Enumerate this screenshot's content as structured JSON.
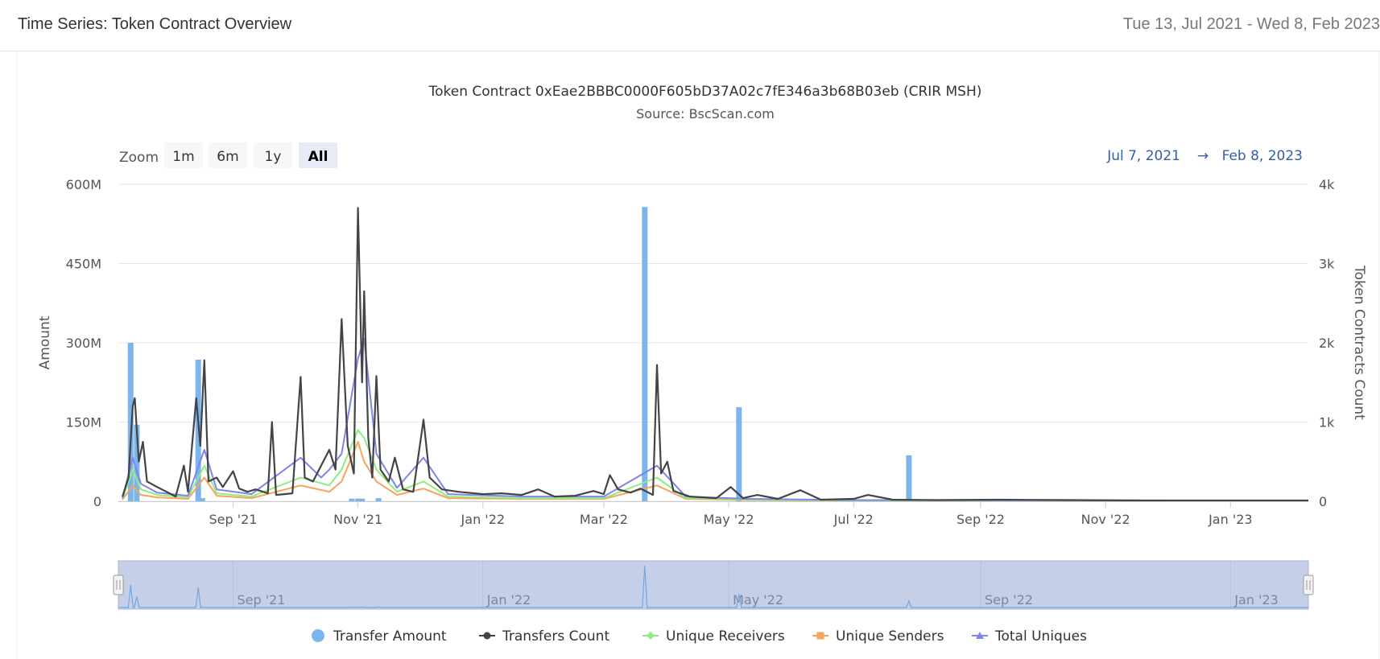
{
  "header": {
    "title": "Time Series: Token Contract Overview",
    "date_range": "Tue 13, Jul 2021 - Wed 8, Feb 2023"
  },
  "chart_data": {
    "type": "line",
    "title": "Token Contract 0xEae2BBBC0000F605bD37A02c7fE346a3b68B03eb (CRIR MSH)",
    "subtitle": "Source: BscScan.com",
    "ylabel_left": "Amount",
    "ylabel_right": "Token Contracts Count",
    "ylim_left": [
      0,
      600000000
    ],
    "ylim_right": [
      0,
      4000
    ],
    "yticks_left": [
      "0",
      "150M",
      "300M",
      "450M",
      "600M"
    ],
    "yticks_right": [
      "0",
      "1k",
      "2k",
      "3k",
      "4k"
    ],
    "xlim": [
      "2021-07-07",
      "2023-02-08"
    ],
    "xticks": [
      {
        "date": "2021-09-01",
        "label": "Sep '21"
      },
      {
        "date": "2021-11-01",
        "label": "Nov '21"
      },
      {
        "date": "2022-01-01",
        "label": "Jan '22"
      },
      {
        "date": "2022-03-01",
        "label": "Mar '22"
      },
      {
        "date": "2022-05-01",
        "label": "May '22"
      },
      {
        "date": "2022-07-01",
        "label": "Jul '22"
      },
      {
        "date": "2022-09-01",
        "label": "Sep '22"
      },
      {
        "date": "2022-11-01",
        "label": "Nov '22"
      },
      {
        "date": "2023-01-01",
        "label": "Jan '23"
      }
    ],
    "navigator_ticks": [
      {
        "date": "2021-09-01",
        "label": "Sep '21"
      },
      {
        "date": "2022-01-01",
        "label": "Jan '22"
      },
      {
        "date": "2022-05-01",
        "label": "May '22"
      },
      {
        "date": "2022-09-01",
        "label": "Sep '22"
      },
      {
        "date": "2023-01-01",
        "label": "Jan '23"
      }
    ],
    "grid": true,
    "legend_position": "bottom",
    "series": [
      {
        "name": "Transfer Amount",
        "type": "column",
        "axis": "left",
        "color": "#7cb5ec",
        "points": [
          [
            "2021-07-13",
            300000000
          ],
          [
            "2021-07-16",
            145000000
          ],
          [
            "2021-08-15",
            268000000
          ],
          [
            "2021-08-17",
            6000000
          ],
          [
            "2021-10-29",
            5000000
          ],
          [
            "2021-11-01",
            5000000
          ],
          [
            "2021-11-03",
            5000000
          ],
          [
            "2021-11-11",
            6000000
          ],
          [
            "2022-03-21",
            557000000
          ],
          [
            "2022-05-06",
            178000000
          ],
          [
            "2022-07-28",
            87000000
          ]
        ]
      },
      {
        "name": "Transfers Count",
        "type": "line",
        "axis": "right",
        "color": "#434348",
        "points": [
          [
            "2021-07-09",
            60
          ],
          [
            "2021-07-12",
            300
          ],
          [
            "2021-07-14",
            1200
          ],
          [
            "2021-07-15",
            1300
          ],
          [
            "2021-07-17",
            500
          ],
          [
            "2021-07-19",
            750
          ],
          [
            "2021-07-21",
            250
          ],
          [
            "2021-07-26",
            180
          ],
          [
            "2021-08-01",
            100
          ],
          [
            "2021-08-04",
            60
          ],
          [
            "2021-08-08",
            450
          ],
          [
            "2021-08-10",
            120
          ],
          [
            "2021-08-14",
            1300
          ],
          [
            "2021-08-16",
            700
          ],
          [
            "2021-08-18",
            1780
          ],
          [
            "2021-08-20",
            250
          ],
          [
            "2021-08-24",
            300
          ],
          [
            "2021-08-27",
            180
          ],
          [
            "2021-09-01",
            380
          ],
          [
            "2021-09-04",
            160
          ],
          [
            "2021-09-08",
            120
          ],
          [
            "2021-09-12",
            150
          ],
          [
            "2021-09-18",
            100
          ],
          [
            "2021-09-20",
            1000
          ],
          [
            "2021-09-22",
            80
          ],
          [
            "2021-09-30",
            100
          ],
          [
            "2021-10-04",
            1570
          ],
          [
            "2021-10-06",
            300
          ],
          [
            "2021-10-10",
            250
          ],
          [
            "2021-10-14",
            450
          ],
          [
            "2021-10-18",
            650
          ],
          [
            "2021-10-21",
            400
          ],
          [
            "2021-10-24",
            2300
          ],
          [
            "2021-10-27",
            700
          ],
          [
            "2021-10-30",
            350
          ],
          [
            "2021-11-01",
            3700
          ],
          [
            "2021-11-03",
            1500
          ],
          [
            "2021-11-04",
            2650
          ],
          [
            "2021-11-06",
            800
          ],
          [
            "2021-11-08",
            300
          ],
          [
            "2021-11-10",
            1580
          ],
          [
            "2021-11-12",
            400
          ],
          [
            "2021-11-16",
            250
          ],
          [
            "2021-11-19",
            550
          ],
          [
            "2021-11-23",
            150
          ],
          [
            "2021-11-28",
            120
          ],
          [
            "2021-12-03",
            1030
          ],
          [
            "2021-12-06",
            300
          ],
          [
            "2021-12-12",
            150
          ],
          [
            "2021-12-20",
            120
          ],
          [
            "2022-01-01",
            90
          ],
          [
            "2022-01-10",
            100
          ],
          [
            "2022-01-20",
            80
          ],
          [
            "2022-01-28",
            150
          ],
          [
            "2022-02-05",
            60
          ],
          [
            "2022-02-15",
            70
          ],
          [
            "2022-02-24",
            130
          ],
          [
            "2022-03-01",
            90
          ],
          [
            "2022-03-04",
            330
          ],
          [
            "2022-03-08",
            150
          ],
          [
            "2022-03-14",
            110
          ],
          [
            "2022-03-19",
            160
          ],
          [
            "2022-03-25",
            80
          ],
          [
            "2022-03-27",
            1720
          ],
          [
            "2022-03-29",
            350
          ],
          [
            "2022-04-01",
            500
          ],
          [
            "2022-04-04",
            130
          ],
          [
            "2022-04-12",
            60
          ],
          [
            "2022-04-25",
            40
          ],
          [
            "2022-05-02",
            180
          ],
          [
            "2022-05-08",
            40
          ],
          [
            "2022-05-15",
            80
          ],
          [
            "2022-05-25",
            30
          ],
          [
            "2022-06-05",
            140
          ],
          [
            "2022-06-15",
            20
          ],
          [
            "2022-07-01",
            30
          ],
          [
            "2022-07-08",
            80
          ],
          [
            "2022-07-20",
            20
          ],
          [
            "2022-08-10",
            15
          ],
          [
            "2022-09-10",
            20
          ],
          [
            "2022-10-15",
            15
          ],
          [
            "2022-11-20",
            10
          ],
          [
            "2023-01-01",
            10
          ],
          [
            "2023-02-08",
            10
          ]
        ]
      },
      {
        "name": "Unique Receivers",
        "type": "line",
        "axis": "right",
        "color": "#90ed7d",
        "points": [
          [
            "2021-07-09",
            30
          ],
          [
            "2021-07-14",
            400
          ],
          [
            "2021-07-18",
            150
          ],
          [
            "2021-07-26",
            80
          ],
          [
            "2021-08-10",
            50
          ],
          [
            "2021-08-18",
            450
          ],
          [
            "2021-08-24",
            100
          ],
          [
            "2021-09-10",
            60
          ],
          [
            "2021-10-04",
            300
          ],
          [
            "2021-10-18",
            200
          ],
          [
            "2021-10-24",
            400
          ],
          [
            "2021-11-01",
            900
          ],
          [
            "2021-11-04",
            800
          ],
          [
            "2021-11-10",
            400
          ],
          [
            "2021-11-20",
            120
          ],
          [
            "2021-12-03",
            250
          ],
          [
            "2021-12-15",
            60
          ],
          [
            "2022-01-20",
            40
          ],
          [
            "2022-03-01",
            40
          ],
          [
            "2022-03-27",
            300
          ],
          [
            "2022-04-10",
            40
          ],
          [
            "2022-05-10",
            20
          ],
          [
            "2022-07-01",
            10
          ],
          [
            "2023-02-08",
            5
          ]
        ]
      },
      {
        "name": "Unique Senders",
        "type": "line",
        "axis": "right",
        "color": "#f7a35c",
        "points": [
          [
            "2021-07-09",
            20
          ],
          [
            "2021-07-14",
            200
          ],
          [
            "2021-07-18",
            80
          ],
          [
            "2021-07-26",
            50
          ],
          [
            "2021-08-10",
            30
          ],
          [
            "2021-08-18",
            300
          ],
          [
            "2021-08-24",
            70
          ],
          [
            "2021-09-10",
            40
          ],
          [
            "2021-10-04",
            200
          ],
          [
            "2021-10-18",
            120
          ],
          [
            "2021-10-24",
            250
          ],
          [
            "2021-11-01",
            750
          ],
          [
            "2021-11-04",
            500
          ],
          [
            "2021-11-10",
            250
          ],
          [
            "2021-11-20",
            80
          ],
          [
            "2021-12-03",
            160
          ],
          [
            "2021-12-15",
            40
          ],
          [
            "2022-01-20",
            30
          ],
          [
            "2022-03-01",
            30
          ],
          [
            "2022-03-27",
            200
          ],
          [
            "2022-04-10",
            30
          ],
          [
            "2022-05-10",
            15
          ],
          [
            "2022-07-01",
            8
          ],
          [
            "2023-02-08",
            4
          ]
        ]
      },
      {
        "name": "Total Uniques",
        "type": "line",
        "axis": "right",
        "color": "#8085e9",
        "points": [
          [
            "2021-07-09",
            40
          ],
          [
            "2021-07-14",
            550
          ],
          [
            "2021-07-18",
            220
          ],
          [
            "2021-07-26",
            110
          ],
          [
            "2021-08-10",
            70
          ],
          [
            "2021-08-18",
            650
          ],
          [
            "2021-08-24",
            150
          ],
          [
            "2021-09-10",
            90
          ],
          [
            "2021-10-04",
            550
          ],
          [
            "2021-10-14",
            300
          ],
          [
            "2021-10-18",
            400
          ],
          [
            "2021-10-24",
            600
          ],
          [
            "2021-11-01",
            1800
          ],
          [
            "2021-11-04",
            2050
          ],
          [
            "2021-11-10",
            600
          ],
          [
            "2021-11-20",
            170
          ],
          [
            "2021-12-03",
            550
          ],
          [
            "2021-12-15",
            90
          ],
          [
            "2022-01-20",
            60
          ],
          [
            "2022-03-01",
            60
          ],
          [
            "2022-03-27",
            450
          ],
          [
            "2022-04-10",
            60
          ],
          [
            "2022-05-10",
            30
          ],
          [
            "2022-07-01",
            15
          ],
          [
            "2023-02-08",
            8
          ]
        ]
      }
    ]
  },
  "zoom": {
    "label": "Zoom",
    "buttons": [
      "1m",
      "6m",
      "1y",
      "All"
    ],
    "active": "All"
  },
  "range": {
    "from": "Jul 7, 2021",
    "arrow": "→",
    "to": "Feb 8, 2023"
  }
}
